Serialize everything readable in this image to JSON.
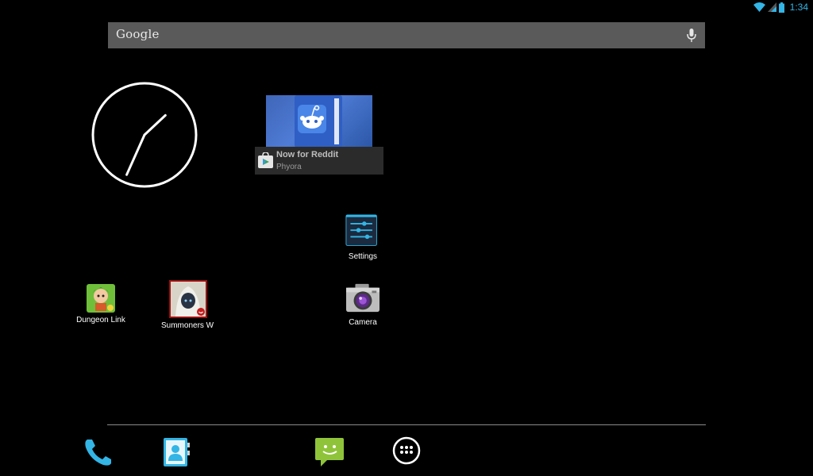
{
  "status_bar": {
    "time": "1:34",
    "icons": [
      "wifi-icon",
      "signal-icon",
      "battery-icon"
    ],
    "accent_color": "#33b5e5"
  },
  "search": {
    "logo_text": "Google",
    "mic_icon": "microphone-icon"
  },
  "clock": {
    "type": "analog",
    "hour": 1,
    "minute": 34
  },
  "widget": {
    "title": "Now for Reddit",
    "subtitle": "Phyora",
    "store_icon": "play-store-icon"
  },
  "apps": [
    {
      "label": "Settings",
      "icon": "settings-icon"
    },
    {
      "label": "Dungeon Link",
      "icon": "dungeon-link-icon"
    },
    {
      "label": "Summoners W",
      "icon": "summoners-war-icon"
    },
    {
      "label": "Camera",
      "icon": "camera-icon"
    }
  ],
  "dock": [
    {
      "icon": "phone-icon"
    },
    {
      "icon": "contacts-icon"
    },
    {
      "icon": "messaging-icon"
    },
    {
      "icon": "app-drawer-icon"
    }
  ]
}
